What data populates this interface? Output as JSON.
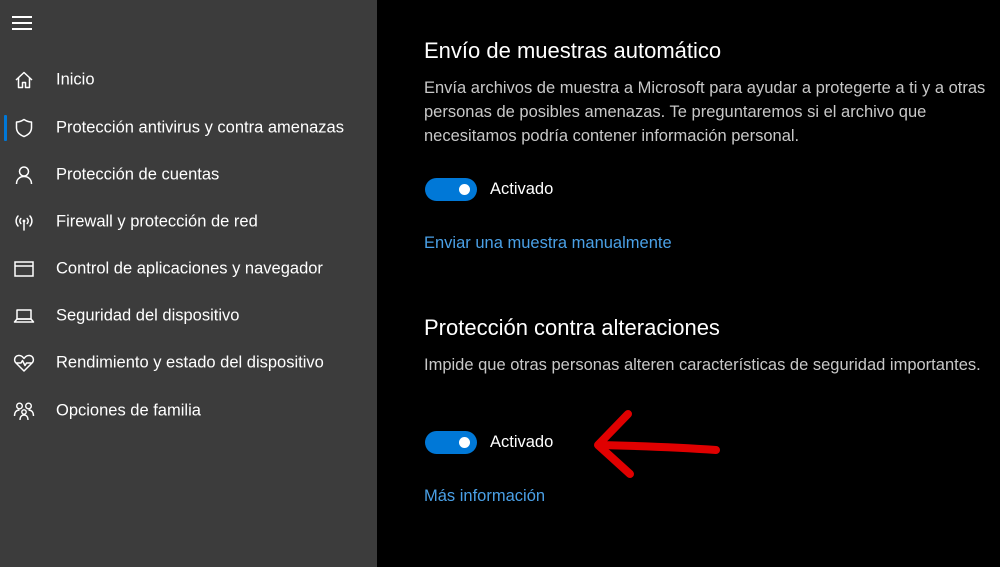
{
  "sidebar": {
    "items": [
      {
        "label": "Inicio",
        "icon": "home-icon"
      },
      {
        "label": "Protección antivirus y contra amenazas",
        "icon": "shield-icon",
        "active": true
      },
      {
        "label": "Protección de cuentas",
        "icon": "person-icon"
      },
      {
        "label": "Firewall y protección de red",
        "icon": "wireless-icon"
      },
      {
        "label": "Control de aplicaciones y navegador",
        "icon": "browser-window-icon"
      },
      {
        "label": "Seguridad del dispositivo",
        "icon": "laptop-icon"
      },
      {
        "label": "Rendimiento y estado del dispositivo",
        "icon": "heart-pulse-icon"
      },
      {
        "label": "Opciones de familia",
        "icon": "family-icon"
      }
    ]
  },
  "sample_submission": {
    "title": "Envío de muestras automático",
    "description": "Envía archivos de muestra a Microsoft para ayudar a protegerte a ti y a otras personas de posibles amenazas. Te preguntaremos si el archivo que necesitamos podría contener información personal.",
    "toggle_label": "Activado",
    "toggle_on": true,
    "link": "Enviar una muestra manualmente"
  },
  "tamper_protection": {
    "title": "Protección contra alteraciones",
    "description": "Impide que otras personas alteren características de seguridad importantes.",
    "toggle_label": "Activado",
    "toggle_on": true,
    "link": "Más información"
  },
  "colors": {
    "accent": "#0078d7",
    "link": "#4aa0e6",
    "annotation_arrow": "#e00000",
    "sidebar_bg": "#3c3c3c",
    "main_bg": "#000000"
  }
}
